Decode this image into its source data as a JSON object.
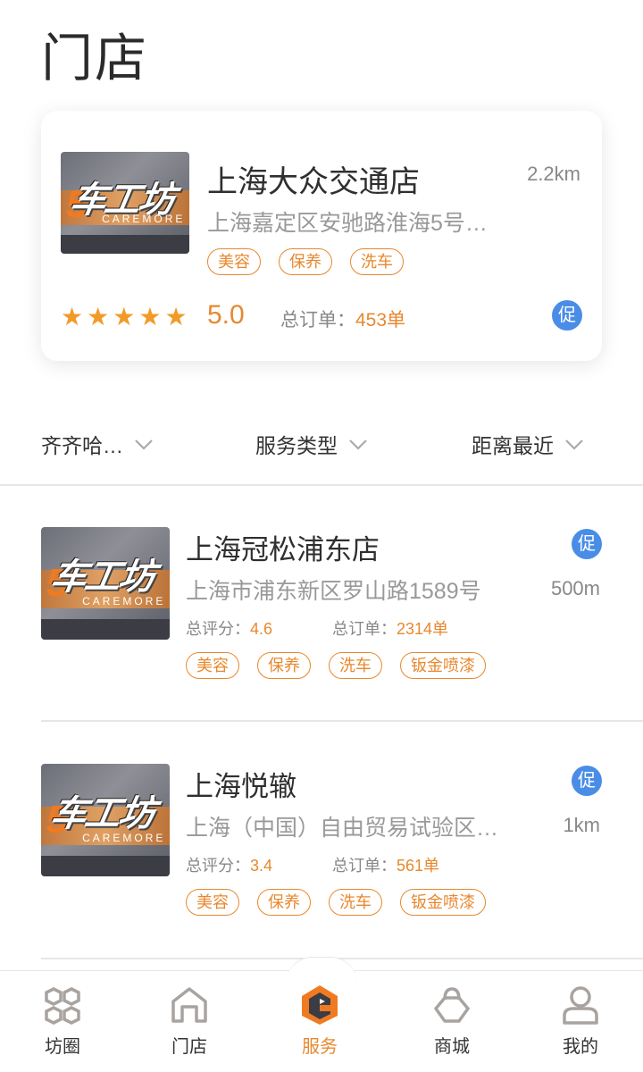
{
  "page": {
    "title": "门店"
  },
  "featured": {
    "name": "上海大众交通店",
    "distance": "2.2km",
    "address": "上海嘉定区安驰路淮海5号…",
    "tags": [
      "美容",
      "保养",
      "洗车"
    ],
    "stars": 5,
    "score": "5.0",
    "orders_label": "总订单：",
    "orders_value": "453单",
    "promo": "促",
    "thumb_brand": "车工坊",
    "thumb_sub": "CAREMORE",
    "thumb_num": "5"
  },
  "filters": [
    {
      "label": "齐齐哈…"
    },
    {
      "label": "服务类型"
    },
    {
      "label": "距离最近"
    }
  ],
  "stores": [
    {
      "name": "上海冠松浦东店",
      "promo": "促",
      "address": "上海市浦东新区罗山路1589号",
      "distance": "500m",
      "rating_label": "总评分：",
      "rating_value": "4.6",
      "orders_label": "总订单：",
      "orders_value": "2314单",
      "tags": [
        "美容",
        "保养",
        "洗车",
        "钣金喷漆"
      ],
      "thumb_brand": "车工坊",
      "thumb_sub": "CAREMORE",
      "thumb_num": "5"
    },
    {
      "name": "上海悦辙",
      "promo": "促",
      "address": "上海（中国）自由贸易试验区…",
      "distance": "1km",
      "rating_label": "总评分：",
      "rating_value": "3.4",
      "orders_label": "总订单：",
      "orders_value": "561单",
      "tags": [
        "美容",
        "保养",
        "洗车",
        "钣金喷漆"
      ],
      "thumb_brand": "车工坊",
      "thumb_sub": "CAREMORE",
      "thumb_num": "5"
    }
  ],
  "nav": [
    {
      "label": "坊圈",
      "icon": "community-icon",
      "active": false
    },
    {
      "label": "门店",
      "icon": "store-icon",
      "active": false
    },
    {
      "label": "服务",
      "icon": "service-logo-icon",
      "active": true
    },
    {
      "label": "商城",
      "icon": "shopping-bag-icon",
      "active": false
    },
    {
      "label": "我的",
      "icon": "profile-icon",
      "active": false
    }
  ],
  "colors": {
    "accent": "#e8882e",
    "promo": "#4a8de6",
    "star": "#f29a27"
  }
}
